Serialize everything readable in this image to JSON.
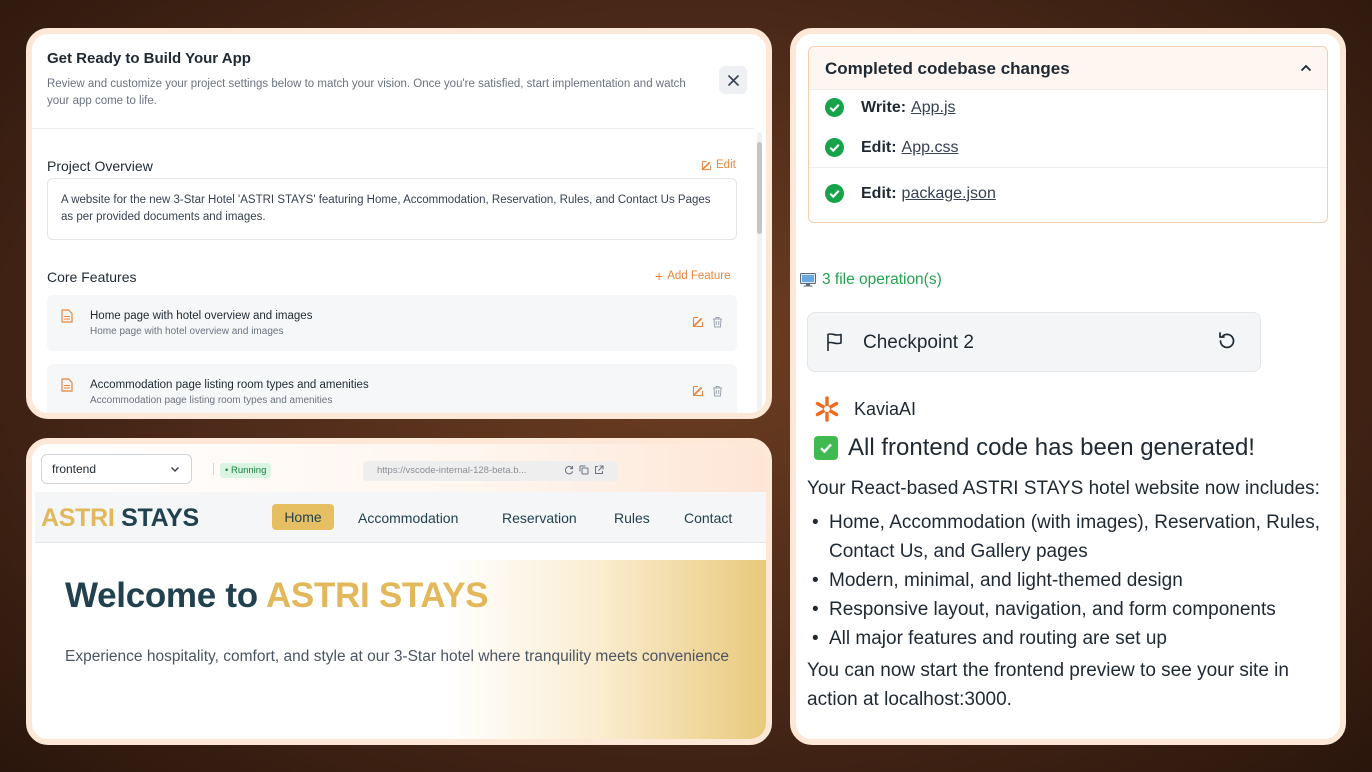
{
  "setup_dialog": {
    "title": "Get Ready to Build Your App",
    "subtitle": "Review and customize your project settings below to match your vision. Once you're satisfied, start implementation and watch your app come to life.",
    "project_overview_heading": "Project Overview",
    "edit_label": "Edit",
    "overview_text": "A website for the new 3-Star Hotel 'ASTRI STAYS' featuring Home, Accommodation, Reservation, Rules, and Contact Us Pages as per provided documents and images.",
    "core_features_heading": "Core Features",
    "add_feature_label": "Add Feature",
    "features": [
      {
        "title": "Home page with hotel overview and images",
        "description": "Home page with hotel overview and images"
      },
      {
        "title": "Accommodation page listing room types and amenities",
        "description": "Accommodation page listing room types and amenities"
      }
    ]
  },
  "preview": {
    "container_select": "frontend",
    "status": "Running",
    "url": "https://vscode-internal-128-beta.b...",
    "site": {
      "logo_part1": "ASTRI",
      "logo_part2": "STAYS",
      "nav": [
        "Home",
        "Accommodation",
        "Reservation",
        "Rules",
        "Contact"
      ],
      "hero_title_prefix": "Welcome to ",
      "hero_title_highlight": "ASTRI STAYS",
      "hero_subtitle": "Experience hospitality, comfort, and style at our 3-Star hotel where tranquility meets convenience"
    },
    "colors": {
      "accent_gold": "#e2b85a",
      "navy": "#22414f"
    }
  },
  "chat": {
    "changes_title": "Completed codebase changes",
    "operations": [
      {
        "action": "Write:",
        "file": "App.js"
      },
      {
        "action": "Edit:",
        "file": "App.css"
      },
      {
        "action": "Edit:",
        "file": "package.json"
      }
    ],
    "operations_count": "3 file operation(s)",
    "checkpoint_label": "Checkpoint 2",
    "assistant_name": "KaviaAI",
    "message_title": "All frontend code has been generated!",
    "message_intro": "Your React-based ASTRI STAYS hotel website now includes:",
    "message_points": [
      "Home, Accommodation (with images), Reservation, Rules, Contact Us, and Gallery pages",
      "Modern, minimal, and light-themed design",
      "Responsive layout, navigation, and form components",
      "All major features and routing are set up"
    ],
    "message_outro": "You can now start the frontend preview to see your site in action at localhost:3000."
  }
}
